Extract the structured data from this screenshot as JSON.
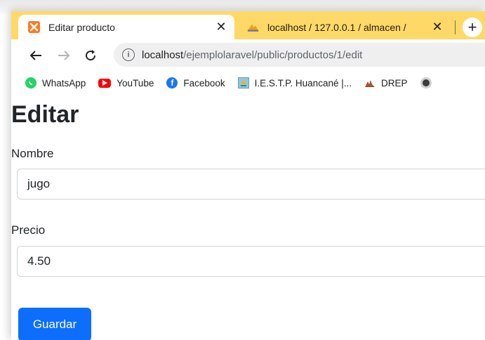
{
  "tabs": [
    {
      "title": "Editar producto",
      "favicon": "xampp-icon",
      "active": true
    },
    {
      "title": "localhost / 127.0.0.1 / almacen /",
      "favicon": "phpmyadmin-icon",
      "active": false
    }
  ],
  "toolbar": {
    "url_host": "localhost",
    "url_path": "/ejemplolaravel/public/productos/1/edit"
  },
  "bookmarks": [
    {
      "label": "WhatsApp",
      "icon": "whatsapp-icon"
    },
    {
      "label": "YouTube",
      "icon": "youtube-icon"
    },
    {
      "label": "Facebook",
      "icon": "facebook-icon"
    },
    {
      "label": "I.E.S.T.P. Huancané |...",
      "icon": "iestp-icon"
    },
    {
      "label": "DREP",
      "icon": "drep-icon"
    }
  ],
  "page": {
    "heading": "Editar",
    "nombre_label": "Nombre",
    "nombre_value": "jugo",
    "precio_label": "Precio",
    "precio_value": "4.50",
    "submit_label": "Guardar"
  },
  "colors": {
    "tabstrip": "#ffd967",
    "primary_button": "#0d6efd"
  }
}
